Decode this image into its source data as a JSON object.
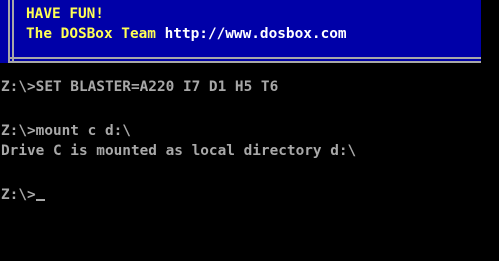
{
  "banner": {
    "line1": "HAVE FUN!",
    "team_text": "The DOSBox Team ",
    "url": "http://www.dosbox.com",
    "colors": {
      "background": "#0000a8",
      "border": "#a8a8a8",
      "highlight": "#ffff54",
      "url": "#ffffff"
    }
  },
  "terminal": {
    "text_color": "#a8a8a8",
    "lines": [
      "Z:\\>SET BLASTER=A220 I7 D1 H5 T6",
      "",
      "Z:\\>mount c d:\\",
      "Drive C is mounted as local directory d:\\",
      "",
      "Z:\\>"
    ]
  }
}
